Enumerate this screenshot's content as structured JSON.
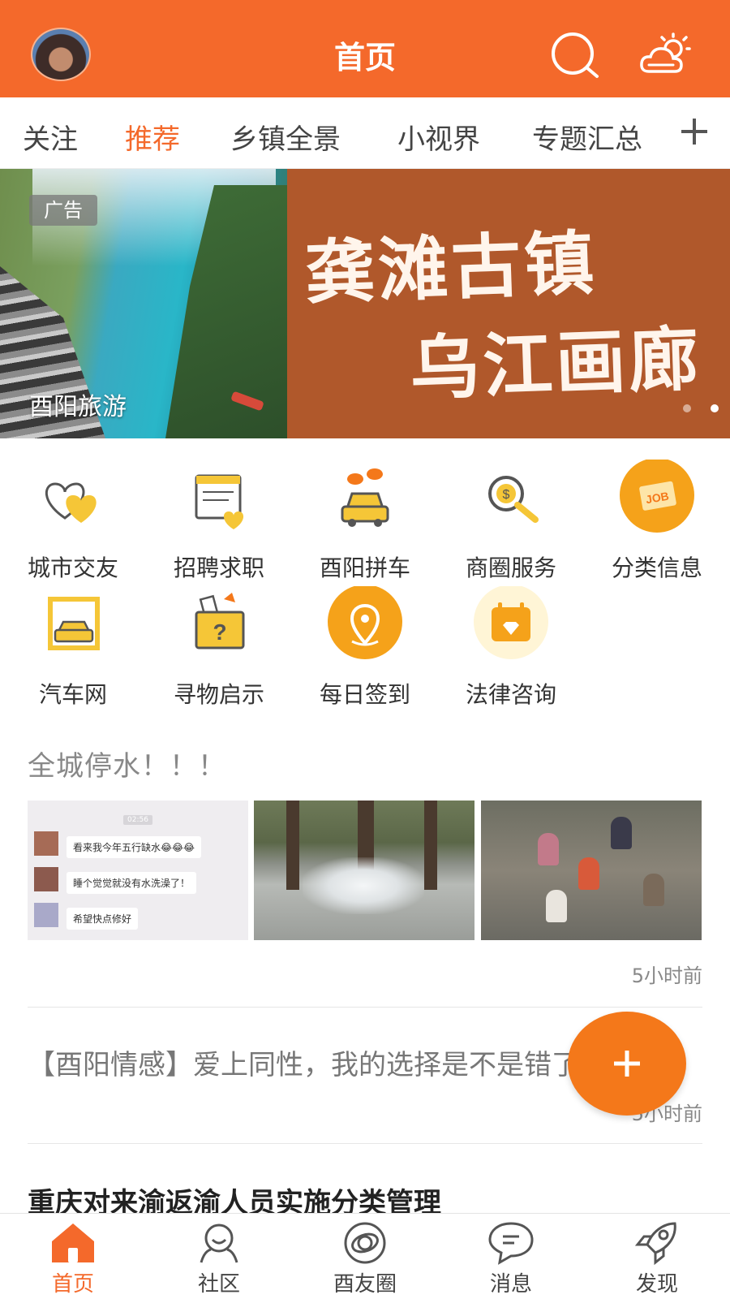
{
  "header": {
    "title": "首页"
  },
  "tabs": [
    {
      "label": "关注",
      "active": false
    },
    {
      "label": "推荐",
      "active": true
    },
    {
      "label": "乡镇全景",
      "active": false
    },
    {
      "label": "小视界",
      "active": false
    },
    {
      "label": "专题汇总",
      "active": false
    }
  ],
  "banner": {
    "ad_label": "广告",
    "caption": "酉阳旅游",
    "headline_line1": "龚滩古镇",
    "headline_line2": "乌江画廊",
    "slide_count": 2,
    "active_slide": 2
  },
  "services": [
    {
      "label": "城市交友",
      "icon": "hearts-icon"
    },
    {
      "label": "招聘求职",
      "icon": "resume-icon"
    },
    {
      "label": "酉阳拼车",
      "icon": "carpool-icon"
    },
    {
      "label": "商圈服务",
      "icon": "coin-magnifier-icon"
    },
    {
      "label": "分类信息",
      "icon": "job-icon"
    },
    {
      "label": "汽车网",
      "icon": "car-garage-icon"
    },
    {
      "label": "寻物启示",
      "icon": "lost-found-icon"
    },
    {
      "label": "每日签到",
      "icon": "location-pin-icon"
    },
    {
      "label": "法律咨询",
      "icon": "calendar-heart-icon"
    }
  ],
  "feed": [
    {
      "title": "全城停水！！！",
      "time": "5小时前",
      "chat_screenshot": {
        "clock": "02:56",
        "messages": [
          "看来我今年五行缺水😂😂😂",
          "睡个觉觉就没有水洗澡了！",
          "希望快点修好"
        ]
      }
    },
    {
      "title": "【酉阳情感】爱上同性，我的选择是不是错了",
      "time": "5小时前"
    },
    {
      "title": "重庆对来渝返渝人员实施分类管理"
    }
  ],
  "bottom_nav": [
    {
      "label": "首页",
      "icon": "home-icon",
      "active": true
    },
    {
      "label": "社区",
      "icon": "community-icon",
      "active": false
    },
    {
      "label": "酉友圈",
      "icon": "planet-icon",
      "active": false
    },
    {
      "label": "消息",
      "icon": "message-icon",
      "active": false
    },
    {
      "label": "发现",
      "icon": "rocket-icon",
      "active": false
    }
  ],
  "colors": {
    "accent": "#f4692b",
    "fab": "#f4781a",
    "icon_yellow": "#f5c637"
  }
}
